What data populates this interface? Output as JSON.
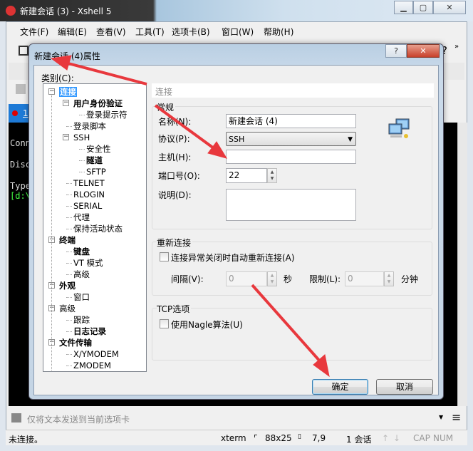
{
  "window": {
    "title": "新建会话 (3) - Xshell 5",
    "controls": [
      "minimize",
      "maximize",
      "close"
    ]
  },
  "menu": [
    "文件(F)",
    "编辑(E)",
    "查看(V)",
    "工具(T)",
    "选项卡(B)",
    "窗口(W)",
    "帮助(H)"
  ],
  "tab": {
    "label": "1",
    "status_color": "#e00000"
  },
  "terminal": {
    "lines": [
      "Conn",
      "Disc",
      "Type",
      "[d:\\"
    ]
  },
  "sendbar": {
    "placeholder": "仅将文本发送到当前选项卡"
  },
  "statusbar": {
    "status": "未连接。",
    "term": "xterm",
    "size": "88x25",
    "pos": "7,9",
    "sessions": "1 会话",
    "cap": "CAP",
    "num": "NUM"
  },
  "dialog": {
    "title": "新建会话 (4)属性",
    "category_label": "类别(C):",
    "tree": [
      {
        "label": "连接",
        "level": 0,
        "bold": true,
        "selected": true,
        "expander": true
      },
      {
        "label": "用户身份验证",
        "level": 1,
        "bold": true,
        "expander": true
      },
      {
        "label": "登录提示符",
        "level": 2
      },
      {
        "label": "登录脚本",
        "level": 1
      },
      {
        "label": "SSH",
        "level": 1,
        "expander": true
      },
      {
        "label": "安全性",
        "level": 2
      },
      {
        "label": "隧道",
        "level": 2,
        "bold": true
      },
      {
        "label": "SFTP",
        "level": 2
      },
      {
        "label": "TELNET",
        "level": 1
      },
      {
        "label": "RLOGIN",
        "level": 1
      },
      {
        "label": "SERIAL",
        "level": 1
      },
      {
        "label": "代理",
        "level": 1
      },
      {
        "label": "保持活动状态",
        "level": 1
      },
      {
        "label": "终端",
        "level": 0,
        "bold": true,
        "expander": true
      },
      {
        "label": "键盘",
        "level": 1,
        "bold": true
      },
      {
        "label": "VT 模式",
        "level": 1
      },
      {
        "label": "高级",
        "level": 1
      },
      {
        "label": "外观",
        "level": 0,
        "bold": true,
        "expander": true
      },
      {
        "label": "窗口",
        "level": 1
      },
      {
        "label": "高级",
        "level": 0,
        "expander": true
      },
      {
        "label": "跟踪",
        "level": 1
      },
      {
        "label": "日志记录",
        "level": 1,
        "bold": true
      },
      {
        "label": "文件传输",
        "level": 0,
        "bold": true,
        "expander": true
      },
      {
        "label": "X/YMODEM",
        "level": 1
      },
      {
        "label": "ZMODEM",
        "level": 1
      }
    ],
    "section_header": "连接",
    "general": {
      "label": "常规",
      "name_label": "名称(N):",
      "name_value": "新建会话 (4)",
      "protocol_label": "协议(P):",
      "protocol_value": "SSH",
      "host_label": "主机(H):",
      "host_value": "",
      "port_label": "端口号(O):",
      "port_value": "22",
      "desc_label": "说明(D):",
      "desc_value": ""
    },
    "reconnect": {
      "label": "重新连接",
      "checkbox": "连接异常关闭时自动重新连接(A)",
      "checked": false,
      "interval_label": "间隔(V):",
      "interval_value": "0",
      "interval_unit": "秒",
      "limit_label": "限制(L):",
      "limit_value": "0",
      "limit_unit": "分钟"
    },
    "tcp": {
      "label": "TCP选项",
      "checkbox": "使用Nagle算法(U)",
      "checked": false
    },
    "ok": "确定",
    "cancel": "取消"
  },
  "annotation_color": "#e8383d"
}
